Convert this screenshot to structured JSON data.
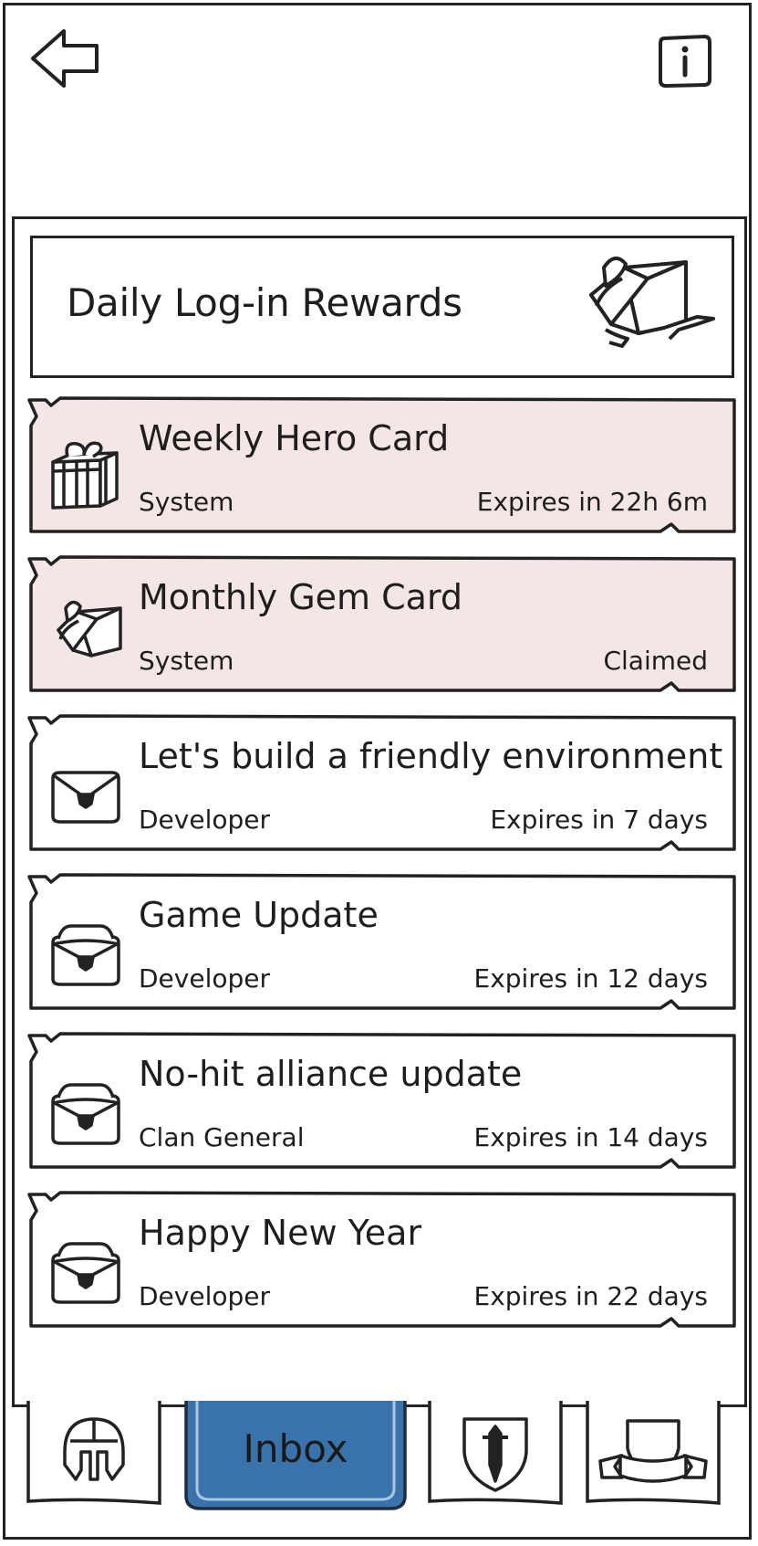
{
  "header": {
    "back_icon": "arrow-left-icon",
    "info_icon": "info-icon"
  },
  "rewards": {
    "title": "Daily Log-in Rewards",
    "icon": "gift-box-icon"
  },
  "colors": {
    "highlight": "#f5e6e6",
    "border": "#222222",
    "active_tab": "#3a73ac",
    "active_tab_inner": "#a9c6e3"
  },
  "mails": [
    {
      "title": "Weekly Hero Card",
      "sender": "System",
      "expiry": "Expires in 22h 6m",
      "icon": "gift-icon",
      "highlight": true
    },
    {
      "title": "Monthly Gem Card",
      "sender": "System",
      "expiry": "Claimed",
      "icon": "open-box-icon",
      "highlight": true
    },
    {
      "title": "Let's build a friendly environment",
      "sender": "Developer",
      "expiry": "Expires in 7 days",
      "icon": "envelope-icon",
      "highlight": false
    },
    {
      "title": "Game Update",
      "sender": "Developer",
      "expiry": "Expires in 12 days",
      "icon": "open-envelope-icon",
      "highlight": false
    },
    {
      "title": "No-hit alliance update",
      "sender": "Clan General",
      "expiry": "Expires in 14 days",
      "icon": "open-envelope-icon",
      "highlight": false
    },
    {
      "title": "Happy New Year",
      "sender": "Developer",
      "expiry": "Expires in 22 days",
      "icon": "open-envelope-icon",
      "highlight": false
    }
  ],
  "tabs": [
    {
      "icon": "helmet-icon",
      "active": false
    },
    {
      "label": "Inbox",
      "active": true
    },
    {
      "icon": "shield-sword-icon",
      "active": false
    },
    {
      "icon": "banner-crest-icon",
      "active": false
    }
  ]
}
